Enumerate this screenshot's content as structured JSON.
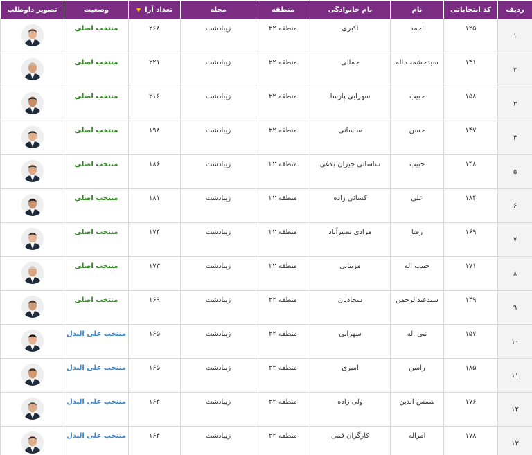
{
  "table": {
    "headers": {
      "row": "ردیف",
      "code": "کد انتخاباتی",
      "first_name": "نام",
      "last_name": "نام خانوادگی",
      "region": "منطقه",
      "district": "محله",
      "votes": "تعداد آرا",
      "status": "وضعیت",
      "photo": "تصویر داوطلب"
    },
    "sort_indicator": "▼",
    "rows": [
      {
        "row": "۱",
        "code": "۱۲۵",
        "first_name": "احمد",
        "last_name": "اکبری",
        "region": "منطقه ۲۲",
        "district": "زیبادشت",
        "votes": "۲۶۸",
        "status": "منتخب اصلی",
        "status_type": "main"
      },
      {
        "row": "۲",
        "code": "۱۴۱",
        "first_name": "سیدحشمت اله",
        "last_name": "جمالی",
        "region": "منطقه ۲۲",
        "district": "زیبادشت",
        "votes": "۲۲۱",
        "status": "منتخب اصلی",
        "status_type": "main"
      },
      {
        "row": "۳",
        "code": "۱۵۸",
        "first_name": "حبیب",
        "last_name": "سهرابی پارسا",
        "region": "منطقه ۲۲",
        "district": "زیبادشت",
        "votes": "۲۱۶",
        "status": "منتخب اصلی",
        "status_type": "main"
      },
      {
        "row": "۴",
        "code": "۱۴۷",
        "first_name": "حسن",
        "last_name": "ساسانی",
        "region": "منطقه ۲۲",
        "district": "زیبادشت",
        "votes": "۱۹۸",
        "status": "منتخب اصلی",
        "status_type": "main"
      },
      {
        "row": "۵",
        "code": "۱۴۸",
        "first_name": "حبیب",
        "last_name": "ساسانی جیران بلاغی",
        "region": "منطقه ۲۲",
        "district": "زیبادشت",
        "votes": "۱۸۶",
        "status": "منتخب اصلی",
        "status_type": "main"
      },
      {
        "row": "۶",
        "code": "۱۸۴",
        "first_name": "علی",
        "last_name": "کسائی زاده",
        "region": "منطقه ۲۲",
        "district": "زیبادشت",
        "votes": "۱۸۱",
        "status": "منتخب اصلی",
        "status_type": "main"
      },
      {
        "row": "۷",
        "code": "۱۶۹",
        "first_name": "رضا",
        "last_name": "مرادی نصیرآباد",
        "region": "منطقه ۲۲",
        "district": "زیبادشت",
        "votes": "۱۷۴",
        "status": "منتخب اصلی",
        "status_type": "main"
      },
      {
        "row": "۸",
        "code": "۱۷۱",
        "first_name": "حبیب اله",
        "last_name": "مزینانی",
        "region": "منطقه ۲۲",
        "district": "زیبادشت",
        "votes": "۱۷۳",
        "status": "منتخب اصلی",
        "status_type": "main"
      },
      {
        "row": "۹",
        "code": "۱۴۹",
        "first_name": "سیدعبدالرحمن",
        "last_name": "سجادیان",
        "region": "منطقه ۲۲",
        "district": "زیبادشت",
        "votes": "۱۶۹",
        "status": "منتخب اصلی",
        "status_type": "main"
      },
      {
        "row": "۱۰",
        "code": "۱۵۷",
        "first_name": "نبی اله",
        "last_name": "سهرابی",
        "region": "منطقه ۲۲",
        "district": "زیبادشت",
        "votes": "۱۶۵",
        "status": "منتخب علی البدل",
        "status_type": "alt"
      },
      {
        "row": "۱۱",
        "code": "۱۸۵",
        "first_name": "رامین",
        "last_name": "امیری",
        "region": "منطقه ۲۲",
        "district": "زیبادشت",
        "votes": "۱۶۵",
        "status": "منتخب علی البدل",
        "status_type": "alt"
      },
      {
        "row": "۱۲",
        "code": "۱۷۶",
        "first_name": "شمس الدین",
        "last_name": "ولی زاده",
        "region": "منطقه ۲۲",
        "district": "زیبادشت",
        "votes": "۱۶۴",
        "status": "منتخب علی البدل",
        "status_type": "alt"
      },
      {
        "row": "۱۳",
        "code": "۱۷۸",
        "first_name": "امراله",
        "last_name": "کارگران قمی",
        "region": "منطقه ۲۲",
        "district": "زیبادشت",
        "votes": "۱۶۴",
        "status": "منتخب علی البدل",
        "status_type": "alt"
      }
    ]
  },
  "colors": {
    "header_bg": "#7b2d83",
    "header_text": "#ffffff",
    "sort_indicator": "#f2c200",
    "status_main": "#2f8a1f",
    "status_alt": "#3a86c8",
    "row_number_bg": "#f3f3f3",
    "border": "#d8d8d8"
  },
  "icons": {
    "sort": "sort-desc-icon",
    "photo": "candidate-photo-icon"
  }
}
